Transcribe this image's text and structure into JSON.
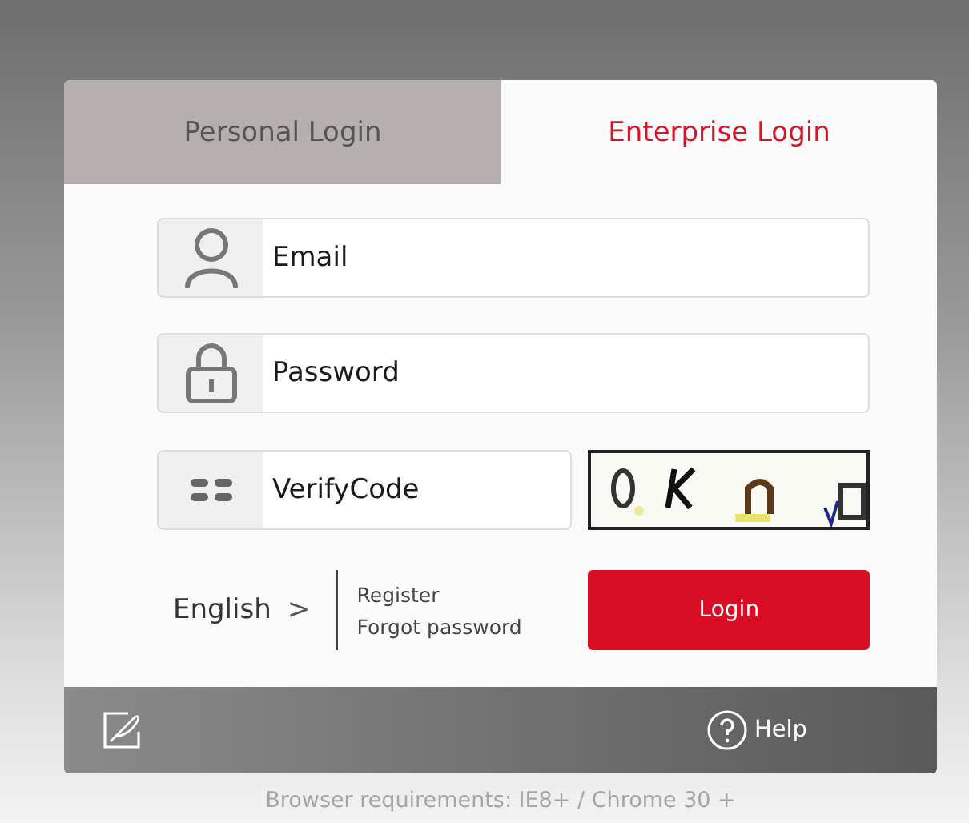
{
  "tabs": [
    {
      "label": "Personal Login",
      "selected": false
    },
    {
      "label": "Enterprise Login",
      "selected": true
    }
  ],
  "fields": [
    {
      "kind": "user",
      "placeholder": "Email"
    },
    {
      "kind": "lock",
      "placeholder": "Password"
    },
    {
      "kind": "code",
      "placeholder": "VerifyCode"
    }
  ],
  "captcha": {
    "kind": "picture"
  },
  "language": {
    "label": "English",
    "chevron": ">"
  },
  "links": [
    "Register",
    "Forgot password"
  ],
  "login_button": "Login",
  "footer": {
    "help": "Help"
  },
  "requirements": "Browser requirements: IE8+ / Chrome 30 +"
}
